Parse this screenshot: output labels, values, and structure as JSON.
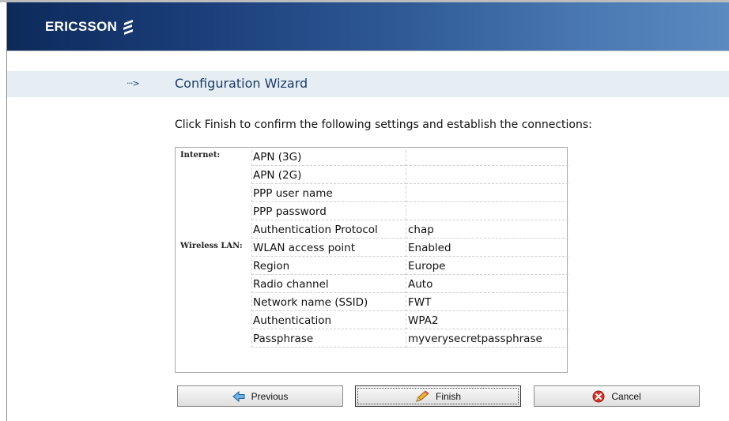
{
  "header": {
    "brand": "ERICSSON"
  },
  "wizard": {
    "title": "Configuration Wizard",
    "instruction": "Click Finish to confirm the following settings and establish the connections:"
  },
  "settings": {
    "rows": [
      {
        "section": "Internet:",
        "label": "APN (3G)",
        "value": ""
      },
      {
        "section": "",
        "label": "APN (2G)",
        "value": ""
      },
      {
        "section": "",
        "label": "PPP user name",
        "value": ""
      },
      {
        "section": "",
        "label": "PPP password",
        "value": ""
      },
      {
        "section": "",
        "label": "Authentication Protocol",
        "value": "chap"
      },
      {
        "section": "Wireless LAN:",
        "label": "WLAN access point",
        "value": "Enabled"
      },
      {
        "section": "",
        "label": "Region",
        "value": "Europe"
      },
      {
        "section": "",
        "label": "Radio channel",
        "value": "Auto"
      },
      {
        "section": "",
        "label": "Network name (SSID)",
        "value": "FWT"
      },
      {
        "section": "",
        "label": "Authentication",
        "value": "WPA2"
      },
      {
        "section": "",
        "label": "Passphrase",
        "value": "myverysecretpassphrase"
      }
    ]
  },
  "buttons": {
    "previous": {
      "label": "Previous",
      "icon": "arrow-left-icon"
    },
    "finish": {
      "label": "Finish",
      "icon": "pencil-icon"
    },
    "cancel": {
      "label": "Cancel",
      "icon": "cancel-icon"
    }
  },
  "colors": {
    "header_dark": "#0d2a5a",
    "header_light": "#5a8ac0",
    "title_bar": "#e6eef3",
    "title_text": "#1b3b6b"
  }
}
